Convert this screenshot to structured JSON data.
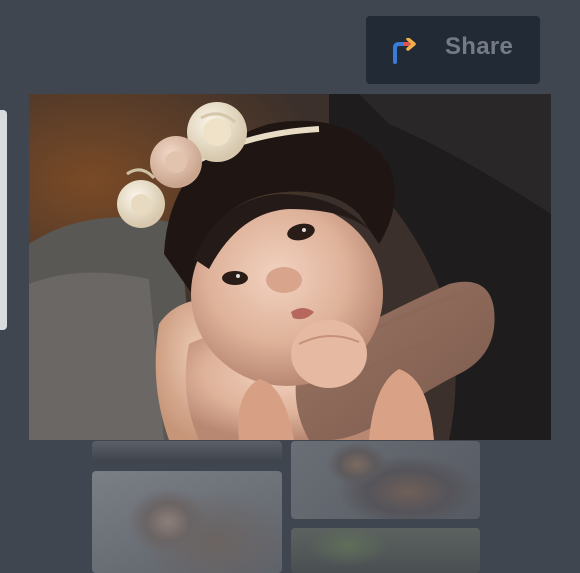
{
  "share": {
    "label": "Share",
    "icon": "share-arrow-icon",
    "icon_colors": [
      "#3b7bd8",
      "#e0524a",
      "#f0b24a"
    ]
  },
  "photo": {
    "subject": "baby-portrait-photo"
  },
  "colors": {
    "background": "#3f4650",
    "share_button_bg": "#222a36",
    "share_text": "#747b87",
    "scrollbar": "#d9dbdf"
  }
}
